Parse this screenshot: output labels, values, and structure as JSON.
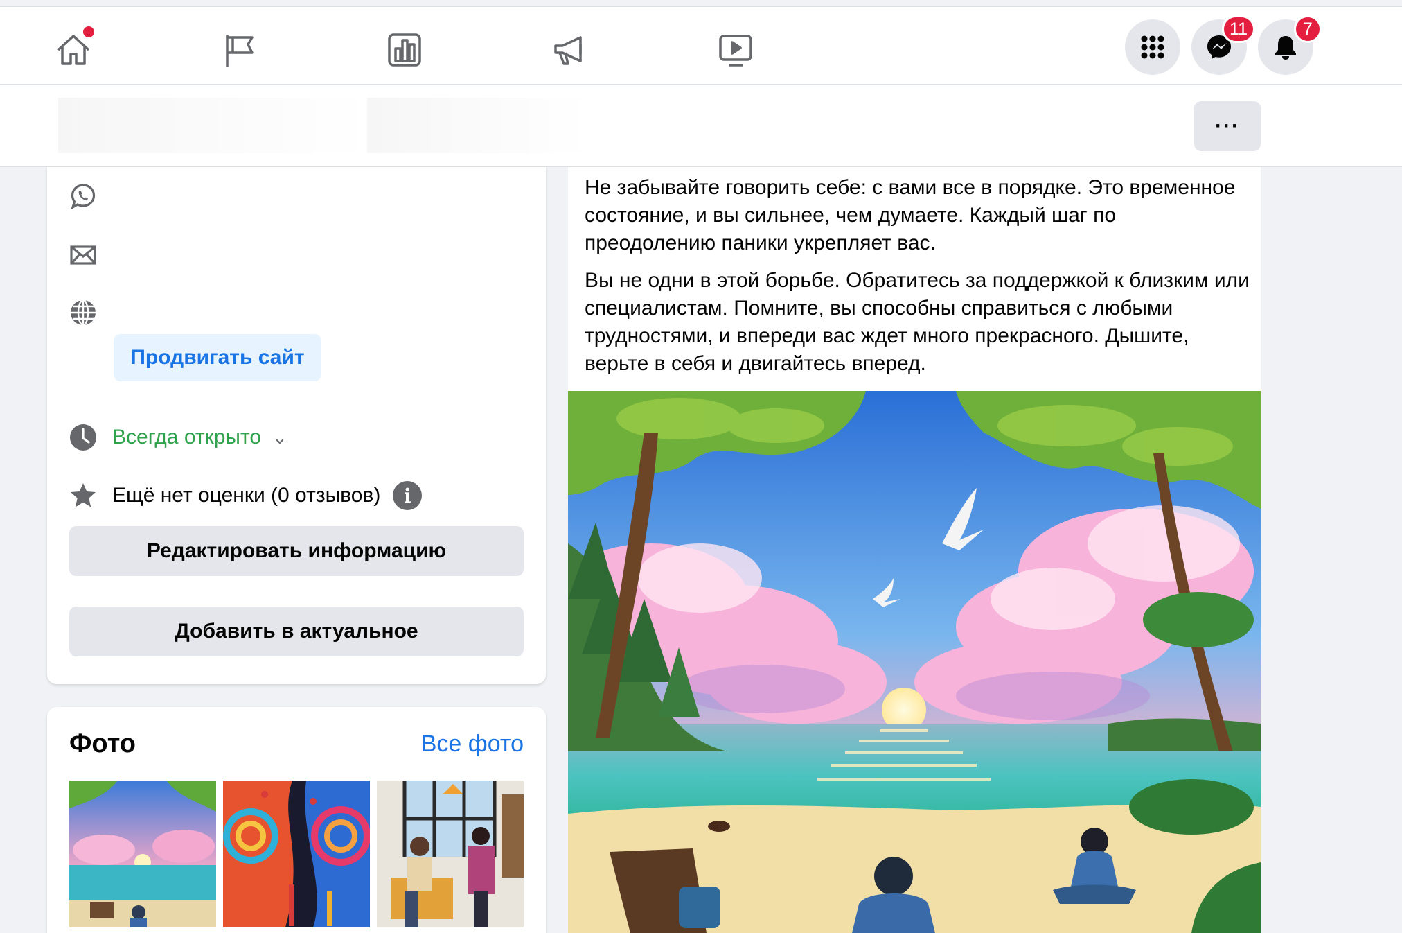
{
  "nav": {
    "icons": [
      "home-icon",
      "flag-icon",
      "insights-icon",
      "megaphone-icon",
      "video-icon"
    ],
    "messenger_badge": "11",
    "notifications_badge": "7"
  },
  "subbar": {
    "more_label": "···"
  },
  "info": {
    "promote_label": "Продвигать сайт",
    "hours_status": "Всегда открыто",
    "rating_text": "Ещё нет оценки (0 отзывов)",
    "edit_label": "Редактировать информацию",
    "featured_label": "Добавить в актуальное"
  },
  "photos": {
    "title": "Фото",
    "all_link": "Все фото"
  },
  "post": {
    "paragraph1": "Не забывайте говорить себе: с вами все в порядке. Это временное состояние, и вы сильнее, чем думаете. Каждый шаг по преодолению паники укрепляет вас.",
    "paragraph2": "Вы не одни в этой борьбе. Обратитесь за поддержкой к близким или специалистам. Помните, вы способны справиться с любыми трудностями, и впереди вас ждет много прекрасного. Дышите, верьте в себя и двигайтесь вперед."
  },
  "colors": {
    "accent": "#1b74e4",
    "open": "#31a24c",
    "badge": "#e41e3f"
  }
}
